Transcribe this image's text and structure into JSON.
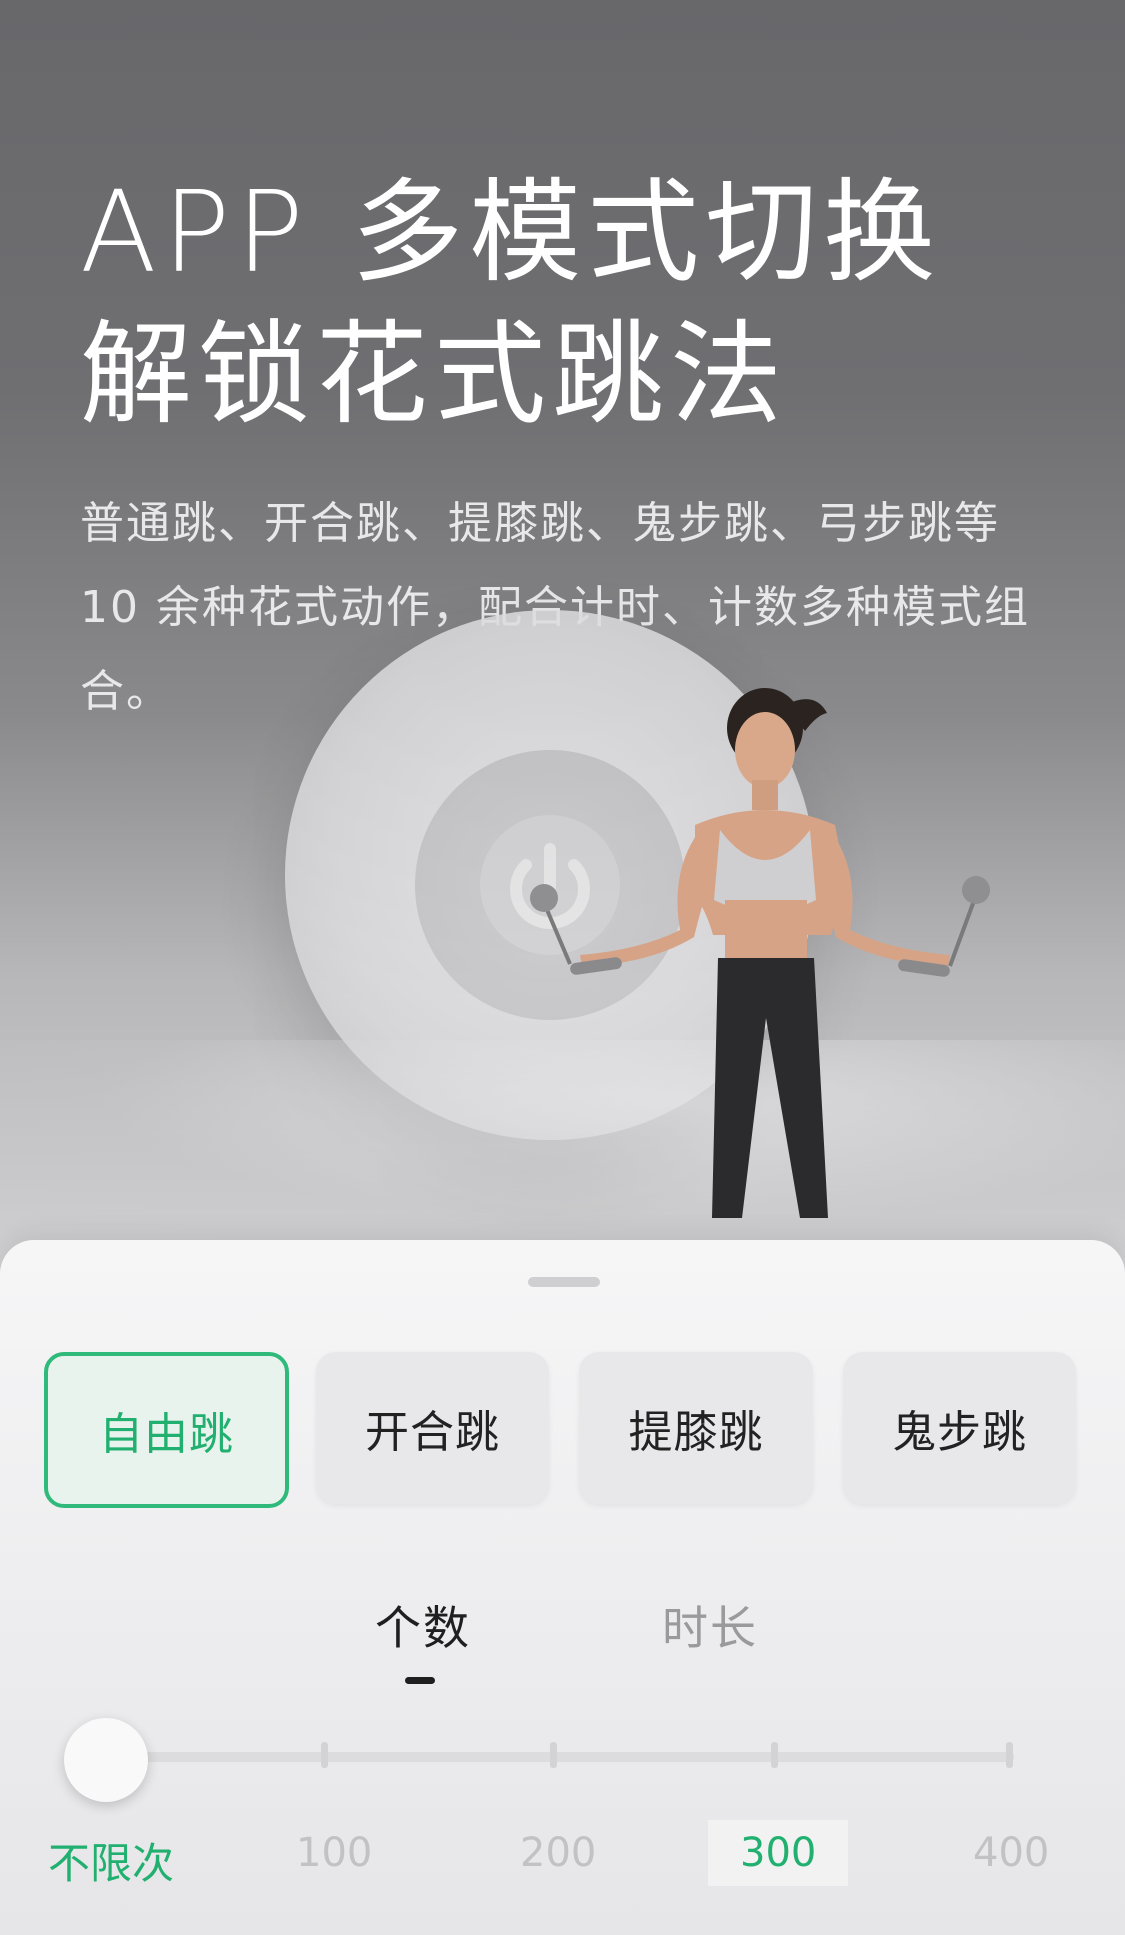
{
  "hero": {
    "title_line1": "APP 多模式切换",
    "title_line2": "解锁花式跳法",
    "description": "普通跳、开合跳、提膝跳、鬼步跳、弓步跳等 10 余种花式动作，配合计时、计数多种模式组合。"
  },
  "modes": [
    {
      "label": "自由跳",
      "active": true
    },
    {
      "label": "开合跳",
      "active": false
    },
    {
      "label": "提膝跳",
      "active": false
    },
    {
      "label": "鬼步跳",
      "active": false
    }
  ],
  "tabs": [
    {
      "label": "个数",
      "active": true
    },
    {
      "label": "时长",
      "active": false
    }
  ],
  "slider": {
    "labels": [
      "不限次",
      "100",
      "200",
      "300",
      "400"
    ],
    "selected": "不限次"
  },
  "colors": {
    "accent": "#2fba7c",
    "accent_text": "#22b070",
    "sheet_bg": "#f2f2f3",
    "hero_bg": "#6b6b6e"
  },
  "icons": {
    "power": "power-icon"
  }
}
